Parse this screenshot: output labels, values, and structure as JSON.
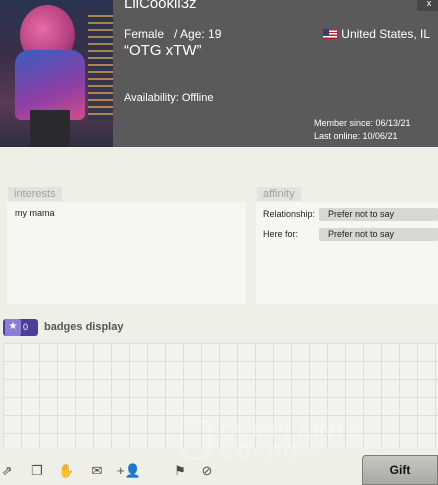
{
  "profile": {
    "username": "LilCookii3z",
    "close_label": "x",
    "gender": "Female",
    "age_text": "/ Age: 19",
    "location": "United States, IL",
    "status_quote": "“OTG xTW”",
    "availability": "Availability: Offline",
    "member_since": "Member since: 06/13/21",
    "last_online": "Last online: 10/06/21"
  },
  "interests": {
    "title": "interests",
    "text": "my mama"
  },
  "affinity": {
    "title": "affinity",
    "relationship_label": "Relationship:",
    "relationship_value": "Prefer not to say",
    "here_for_label": "Here for:",
    "here_for_value": "Prefer not to say"
  },
  "badges": {
    "title": "badges display",
    "count": "0"
  },
  "watermark": {
    "line1": "COMPLAINTS",
    "line2": "BOARD",
    "line3": "BY THE PEOPLE FOR THE PEOPLE"
  },
  "toolbar": {
    "gift_label": "Gift",
    "icons": [
      "share-icon",
      "copy-icon",
      "thumbs-down-icon",
      "mail-icon",
      "add-friend-icon",
      "flag-icon",
      "block-icon"
    ]
  }
}
